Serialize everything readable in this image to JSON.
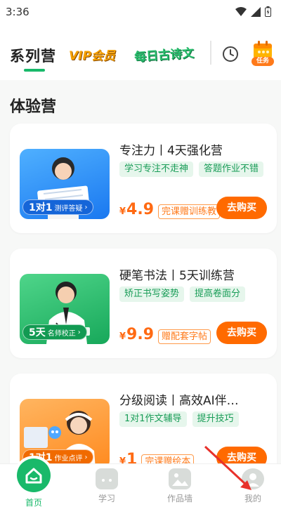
{
  "status": {
    "time": "3:36"
  },
  "nav": {
    "series": "系列营",
    "vip": "VIP会员",
    "poem": "每日古诗文",
    "task_badge": "任务"
  },
  "section_title": "体验营",
  "cards": [
    {
      "title": "专注力丨4天强化营",
      "tags": [
        "学习专注不走神",
        "答题作业不错"
      ],
      "badge_main": "1对1",
      "badge_sub": "测评答疑",
      "currency": "¥",
      "price": "4.9",
      "price_note": "完课赠训练教",
      "buy": "去购买"
    },
    {
      "title": "硬笔书法丨5天训练营",
      "tags": [
        "矫正书写姿势",
        "提高卷面分"
      ],
      "badge_main": "5天",
      "badge_sub": "名师校正",
      "currency": "¥",
      "price": "9.9",
      "price_note": "赠配套字帖",
      "buy": "去购买"
    },
    {
      "title": "分级阅读丨高效AI伴…",
      "tags": [
        "1对1作文辅导",
        "提升技巧"
      ],
      "badge_main": "1对1",
      "badge_sub": "作业点评",
      "currency": "¥",
      "price": "1",
      "price_note": "完课赠绘本",
      "buy": "去购买"
    }
  ],
  "tabs": [
    {
      "label": "首页",
      "icon": "home-icon"
    },
    {
      "label": "学习",
      "icon": "tv-icon"
    },
    {
      "label": "作品墙",
      "icon": "gallery-icon"
    },
    {
      "label": "我的",
      "icon": "profile-icon"
    }
  ],
  "colors": {
    "brand": "#19b96a",
    "accent": "#ff6a00"
  }
}
